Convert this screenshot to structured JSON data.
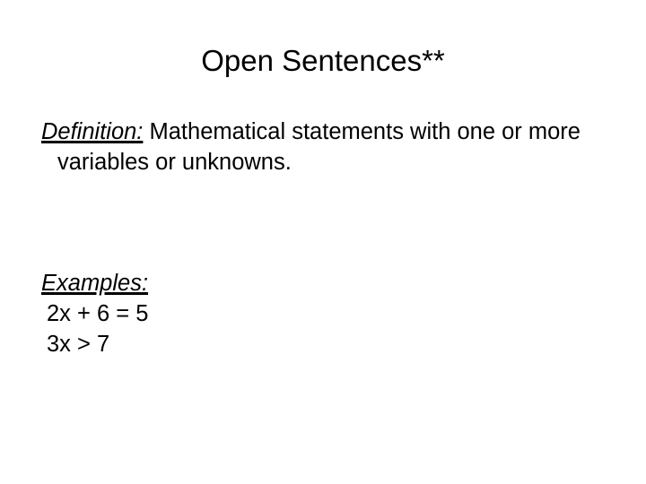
{
  "slide": {
    "title": "Open Sentences**",
    "definition": {
      "term": "Definition:",
      "spacer": "  ",
      "text": "Mathematical statements with one or more variables or unknowns."
    },
    "examples": {
      "heading": "Examples:",
      "items": [
        "2x + 6 = 5",
        "3x > 7"
      ]
    }
  },
  "style": {
    "background_color": "#ffffff",
    "text_color": "#000000"
  }
}
